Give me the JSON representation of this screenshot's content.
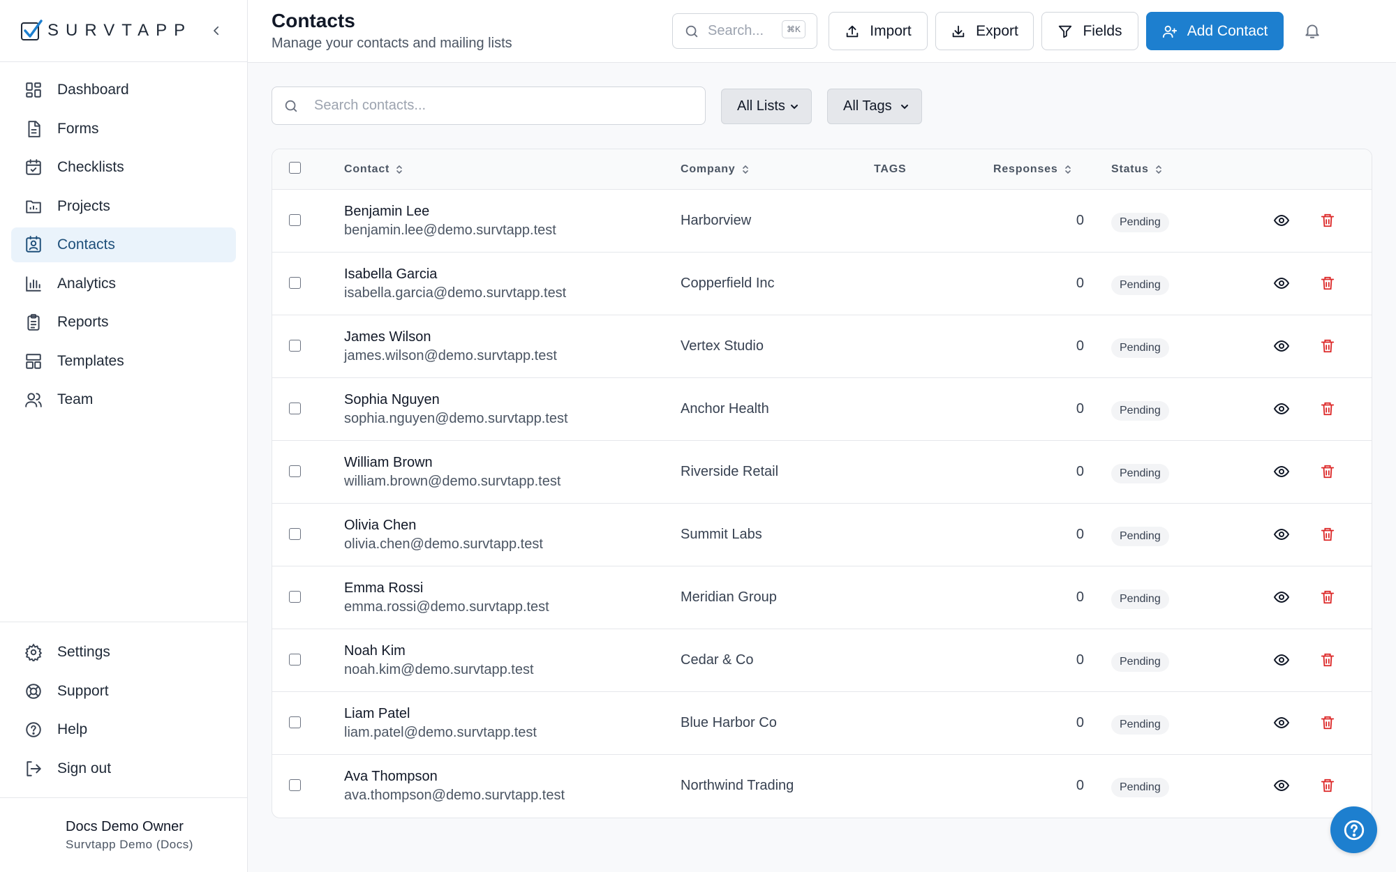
{
  "brand": {
    "name": "SURVTAPP",
    "accent": "#1d7fcf"
  },
  "sidebar": {
    "items": [
      {
        "label": "Dashboard",
        "icon": "dashboard-icon",
        "active": false
      },
      {
        "label": "Forms",
        "icon": "file-text-icon",
        "active": false
      },
      {
        "label": "Checklists",
        "icon": "calendar-check-icon",
        "active": false
      },
      {
        "label": "Projects",
        "icon": "folder-chart-icon",
        "active": false
      },
      {
        "label": "Contacts",
        "icon": "contact-card-icon",
        "active": true
      },
      {
        "label": "Analytics",
        "icon": "bar-chart-icon",
        "active": false
      },
      {
        "label": "Reports",
        "icon": "clipboard-list-icon",
        "active": false
      },
      {
        "label": "Templates",
        "icon": "layout-template-icon",
        "active": false
      },
      {
        "label": "Team",
        "icon": "users-icon",
        "active": false
      }
    ],
    "bottom_items": [
      {
        "label": "Settings",
        "icon": "gear-icon"
      },
      {
        "label": "Support",
        "icon": "life-buoy-icon"
      },
      {
        "label": "Help",
        "icon": "help-circle-icon"
      },
      {
        "label": "Sign out",
        "icon": "log-out-icon"
      }
    ],
    "user": {
      "name": "Docs Demo Owner",
      "org": "Survtapp Demo (Docs)"
    }
  },
  "header": {
    "title": "Contacts",
    "subtitle": "Manage your contacts and mailing lists",
    "search_placeholder": "Search...",
    "shortcut": "⌘K",
    "buttons": {
      "import": "Import",
      "export": "Export",
      "fields": "Fields",
      "add": "Add Contact"
    }
  },
  "filters": {
    "search_placeholder": "Search contacts...",
    "lists_selected": "All Lists",
    "tags_selected": "All Tags"
  },
  "table": {
    "columns": {
      "contact": "Contact",
      "company": "Company",
      "tags": "TAGS",
      "responses": "Responses",
      "status": "Status"
    },
    "rows": [
      {
        "name": "Benjamin Lee",
        "email": "benjamin.lee@demo.survtapp.test",
        "company": "Harborview",
        "responses": "0",
        "status": "Pending"
      },
      {
        "name": "Isabella Garcia",
        "email": "isabella.garcia@demo.survtapp.test",
        "company": "Copperfield Inc",
        "responses": "0",
        "status": "Pending"
      },
      {
        "name": "James Wilson",
        "email": "james.wilson@demo.survtapp.test",
        "company": "Vertex Studio",
        "responses": "0",
        "status": "Pending"
      },
      {
        "name": "Sophia Nguyen",
        "email": "sophia.nguyen@demo.survtapp.test",
        "company": "Anchor Health",
        "responses": "0",
        "status": "Pending"
      },
      {
        "name": "William Brown",
        "email": "william.brown@demo.survtapp.test",
        "company": "Riverside Retail",
        "responses": "0",
        "status": "Pending"
      },
      {
        "name": "Olivia Chen",
        "email": "olivia.chen@demo.survtapp.test",
        "company": "Summit Labs",
        "responses": "0",
        "status": "Pending"
      },
      {
        "name": "Emma Rossi",
        "email": "emma.rossi@demo.survtapp.test",
        "company": "Meridian Group",
        "responses": "0",
        "status": "Pending"
      },
      {
        "name": "Noah Kim",
        "email": "noah.kim@demo.survtapp.test",
        "company": "Cedar & Co",
        "responses": "0",
        "status": "Pending"
      },
      {
        "name": "Liam Patel",
        "email": "liam.patel@demo.survtapp.test",
        "company": "Blue Harbor Co",
        "responses": "0",
        "status": "Pending"
      },
      {
        "name": "Ava Thompson",
        "email": "ava.thompson@demo.survtapp.test",
        "company": "Northwind Trading",
        "responses": "0",
        "status": "Pending"
      }
    ]
  }
}
